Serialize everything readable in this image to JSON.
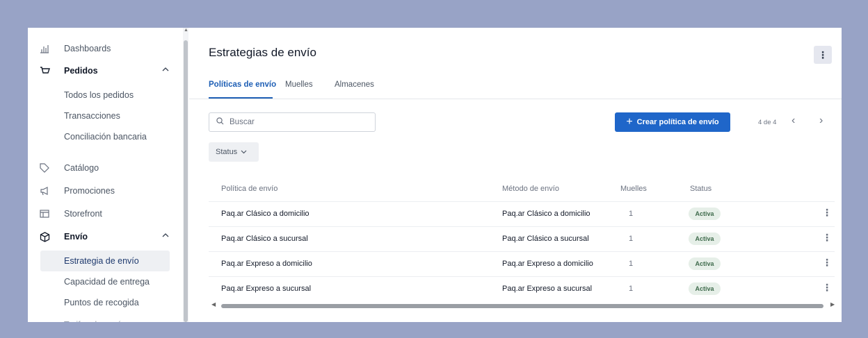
{
  "sidebar": {
    "items": [
      {
        "label": "Dashboards",
        "icon": "chart-bars-icon"
      },
      {
        "label": "Pedidos",
        "icon": "cart-icon",
        "expanded": true
      },
      {
        "label": "Catálogo",
        "icon": "tag-icon"
      },
      {
        "label": "Promociones",
        "icon": "megaphone-icon"
      },
      {
        "label": "Storefront",
        "icon": "layout-icon"
      },
      {
        "label": "Envío",
        "icon": "box-icon",
        "expanded": true
      }
    ],
    "pedidos_sub": [
      "Todos los pedidos",
      "Transacciones",
      "Conciliación bancaria"
    ],
    "envio_sub": [
      "Estrategia de envío",
      "Capacidad de entrega",
      "Puntos de recogida"
    ],
    "clipped_item": "Tarifas de envío",
    "chevron": "^"
  },
  "main": {
    "title": "Estrategias de envío",
    "tabs": [
      {
        "label": "Políticas de envío",
        "active": true
      },
      {
        "label": "Muelles"
      },
      {
        "label": "Almacenes"
      }
    ],
    "search": {
      "placeholder": "Buscar",
      "icon": "search-icon"
    },
    "create_button": {
      "label": "Crear política de envío",
      "icon": "plus-icon"
    },
    "pager": {
      "text": "4 de 4"
    },
    "status_filter": {
      "label": "Status"
    },
    "table": {
      "headers": [
        "Política de envío",
        "Método de envío",
        "Muelles",
        "Status"
      ],
      "rows": [
        {
          "policy": "Paq.ar Clásico a domicilio",
          "method": "Paq.ar Clásico a domicilio",
          "docks": "1",
          "status": "Activa"
        },
        {
          "policy": "Paq.ar Clásico a sucursal",
          "method": "Paq.ar Clásico a sucursal",
          "docks": "1",
          "status": "Activa"
        },
        {
          "policy": "Paq.ar Expreso a domicilio",
          "method": "Paq.ar Expreso a domicilio",
          "docks": "1",
          "status": "Activa"
        },
        {
          "policy": "Paq.ar Expreso a sucursal",
          "method": "Paq.ar Expreso a sucursal",
          "docks": "1",
          "status": "Activa"
        }
      ]
    }
  },
  "colors": {
    "background": "#98a3c6",
    "primary": "#1f66c9",
    "badge_bg": "#e6efe8",
    "badge_text": "#3f6b4c",
    "active_nav_bg": "#eef0f3"
  }
}
